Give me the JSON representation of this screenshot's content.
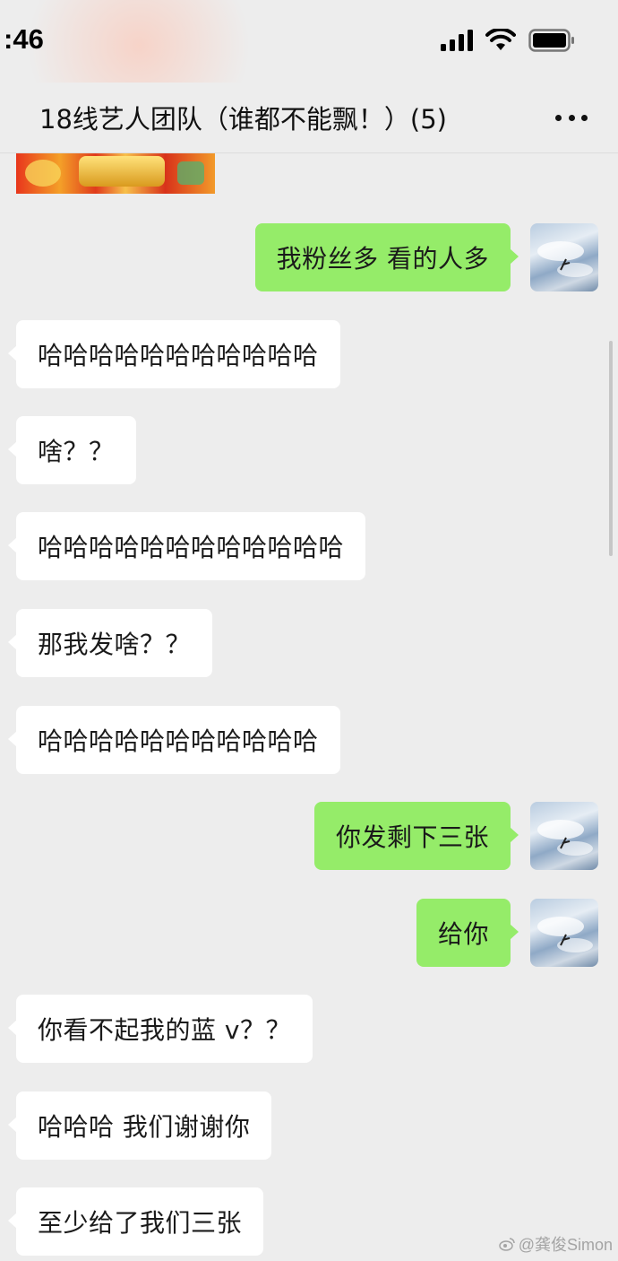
{
  "status_bar": {
    "time": ":46"
  },
  "header": {
    "title": "18线艺人团队（谁都不能飘！）(5)"
  },
  "messages": [
    {
      "side": "right",
      "text": "我粉丝多 看的人多"
    },
    {
      "side": "left",
      "text": "哈哈哈哈哈哈哈哈哈哈哈"
    },
    {
      "side": "left",
      "text": "啥？？"
    },
    {
      "side": "left",
      "text": "哈哈哈哈哈哈哈哈哈哈哈哈"
    },
    {
      "side": "left",
      "text": "那我发啥？？"
    },
    {
      "side": "left",
      "text": "哈哈哈哈哈哈哈哈哈哈哈"
    },
    {
      "side": "right",
      "text": "你发剩下三张"
    },
    {
      "side": "right",
      "text": "给你"
    },
    {
      "side": "left",
      "text": "你看不起我的蓝 v？？"
    },
    {
      "side": "left",
      "text": "哈哈哈 我们谢谢你"
    },
    {
      "side": "left",
      "text": "至少给了我们三张"
    }
  ],
  "watermark": "@龚俊Simon",
  "colors": {
    "sent_bubble": "#95ec69",
    "received_bubble": "#ffffff",
    "background": "#ededed"
  }
}
